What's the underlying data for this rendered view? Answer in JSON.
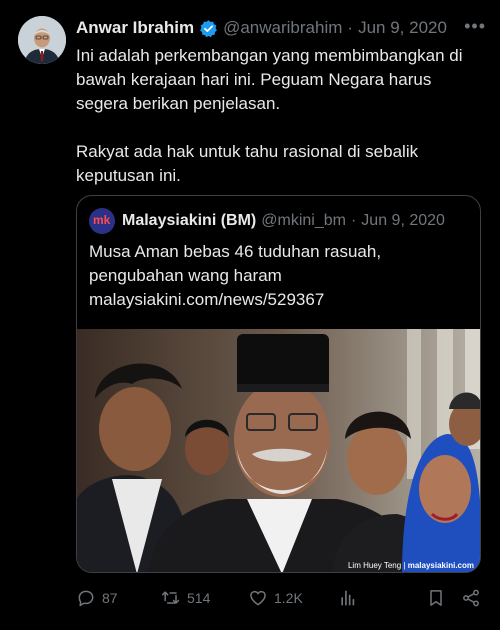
{
  "tweet": {
    "author_name": "Anwar Ibrahim",
    "handle": "@anwaribrahim",
    "separator": "·",
    "date": "Jun 9, 2020",
    "more": "•••",
    "paragraph_1": "Ini adalah perkembangan yang membimbangkan di bawah kerajaan hari ini. Peguam Negara harus segera berikan penjelasan.",
    "paragraph_2": "Rakyat ada hak untuk tahu rasional di sebalik keputusan ini."
  },
  "quote": {
    "logo_text": "mk",
    "author_name": "Malaysiakini (BM)",
    "handle": "@mkini_bm",
    "separator": "·",
    "date": "Jun 9, 2020",
    "line_1": "Musa Aman bebas 46 tuduhan rasuah,",
    "line_2": "pengubahan wang haram",
    "line_3": "malaysiakini.com/news/529367",
    "photo_credit_name": "Lim Huey Teng",
    "photo_credit_site": "malaysiakini.com"
  },
  "actions": {
    "replies": "87",
    "retweets": "514",
    "likes": "1.2K"
  },
  "colors": {
    "background": "#000000",
    "text": "#e7e9ea",
    "muted": "#71767b",
    "verified": "#1d9bf0",
    "border": "#3c4043"
  }
}
